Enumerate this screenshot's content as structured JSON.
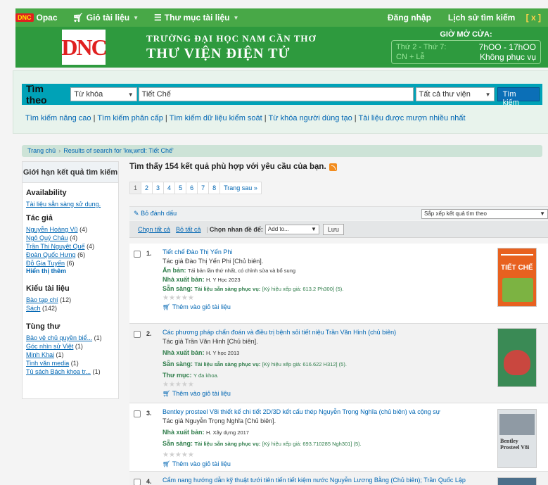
{
  "topnav": {
    "logo": "Opac",
    "cart": "Giỏ tài liệu",
    "catalog": "Thư mục tài liệu",
    "login": "Đăng nhập",
    "history": "Lịch sử tìm kiếm",
    "history_clear": "[ x ]"
  },
  "banner": {
    "logo_text": "DNC",
    "school": "TRƯỜNG ĐẠI HỌC NAM CẦN THƠ",
    "library": "THƯ VIỆN ĐIỆN TỬ",
    "hours_title": "GIỜ MỞ CỬA:",
    "hours": [
      {
        "day": "Thứ 2 - Thứ 7:",
        "time": "7hOO - 17hOO"
      },
      {
        "day": "CN + Lễ",
        "time": "Không phục vụ"
      }
    ]
  },
  "search": {
    "label": "Tìm theo",
    "field": "Từ khóa",
    "query": "Tiết Chế",
    "library": "Tất cả thư viện",
    "button": "Tìm kiếm",
    "links": [
      "Tìm kiếm nâng cao",
      "Tìm kiếm phân cấp",
      "Tìm kiếm dữ liệu kiểm soát",
      "Từ khóa người dùng tạo",
      "Tài liệu được mượn nhiều nhất"
    ]
  },
  "breadcrumb": {
    "home": "Trang chủ",
    "current": "Results of search for 'kw,wrdl: Tiết Chế'"
  },
  "sidebar": {
    "title": "Giới hạn kết quả tìm kiếm",
    "availability": {
      "title": "Availability",
      "item": "Tài liệu sẵn sàng sử dụng."
    },
    "authors": {
      "title": "Tác giả",
      "items": [
        {
          "name": "Nguyễn Hoàng Vũ",
          "count": "(4)"
        },
        {
          "name": "Ngô Quý Châu",
          "count": "(4)"
        },
        {
          "name": "Trần Thị Nguyệt Quế",
          "count": "(4)"
        },
        {
          "name": "Đoàn Quốc Hưng",
          "count": "(6)"
        },
        {
          "name": "Đỗ Gia Tuyến",
          "count": "(6)"
        }
      ],
      "more": "Hiển thị thêm"
    },
    "types": {
      "title": "Kiểu tài liệu",
      "items": [
        {
          "name": "Bào tạp chí",
          "count": "(12)"
        },
        {
          "name": "Sách",
          "count": "(142)"
        }
      ]
    },
    "series": {
      "title": "Tùng thư",
      "items": [
        {
          "name": "Bảo vệ chủ quyền biể...",
          "count": "(1)"
        },
        {
          "name": "Góc nhìn sử Việt",
          "count": "(1)"
        },
        {
          "name": "Minh Khai",
          "count": "(1)"
        },
        {
          "name": "Tinh văn media",
          "count": "(1)"
        },
        {
          "name": "Tủ sách Bách khoa tr...",
          "count": "(1)"
        }
      ]
    }
  },
  "results": {
    "summary": "Tìm thấy 154 kết quả phù hợp với yêu cầu của bạn.",
    "pages": [
      "1",
      "2",
      "3",
      "4",
      "5",
      "6",
      "7",
      "8",
      "Trang sau »"
    ],
    "unhighlight": "Bỏ đánh dấu",
    "sort": "Sắp xếp kết quả tìm theo",
    "select_all": "Chọn tất cả",
    "clear_all": "Bỏ tất cả",
    "tag_label": "Chọn nhan đề để:",
    "add_to": "Add to...",
    "save": "Lưu",
    "add_cart": "Thêm vào giỏ tài liệu",
    "stars": "★★★★★",
    "items": [
      {
        "num": "1.",
        "title": "Tiết chế Đào Thị Yến Phi",
        "author": "Tác giả Đào Thị Yến Phi [Chủ biên].",
        "edition_label": "Ấn bản:",
        "edition": "Tái bản lần thứ nhất, có chỉnh sửa và bổ sung",
        "publisher_label": "Nhà xuất bản:",
        "publisher": "H. Y Học 2023",
        "avail_label": "Sẵn sàng:",
        "avail": "Tài liệu sẵn sàng phục vụ:",
        "call": "[Ký hiệu xếp giá: 613.2 Ph300] (5).",
        "cover_text": "TIẾT CHẾ"
      },
      {
        "num": "2.",
        "title": "Các phương pháp chẩn đoán và điều trị bệnh sỏi tiết niệu Trần Văn Hinh (chủ biên)",
        "author": "Tác giả Trần Văn Hinh [Chủ biên].",
        "publisher_label": "Nhà xuất bản:",
        "publisher": "H. Y học 2013",
        "avail_label": "Sẵn sàng:",
        "avail": "Tài liệu sẵn sàng phục vụ:",
        "call": "[Ký hiệu xếp giá: 616.622 H312] (5).",
        "subject_label": "Thư mục:",
        "subject": "Y đa khoa."
      },
      {
        "num": "3.",
        "title": "Bentley prosteel V8i thiết kế chi tiết 2D/3D kết cấu thép Nguyễn Trọng Nghĩa (chủ biên) và cộng sự",
        "author": "Tác giả Nguyễn Trọng Nghĩa [Chủ biên].",
        "publisher_label": "Nhà xuất bản:",
        "publisher": "H. Xây dựng 2017",
        "avail_label": "Sẵn sàng:",
        "avail": "Tài liệu sẵn sàng phục vụ:",
        "call": "[Ký hiệu xếp giá: 693.710285 Ngh301] (5).",
        "cover_text": "Bentley Prosteel V8i"
      },
      {
        "num": "4.",
        "title": "Cẩm nang hướng dẫn kỹ thuật tưới tiên tiến tiết kiệm nước Nguyễn Lương Bằng (Chủ biên); Trần Quốc Lập"
      }
    ]
  },
  "colors": {
    "nav": "#48a847",
    "banner": "#2e9a3e",
    "searchbar": "#00a2b7",
    "link": "#0066b3",
    "button": "#0b6fb7"
  }
}
